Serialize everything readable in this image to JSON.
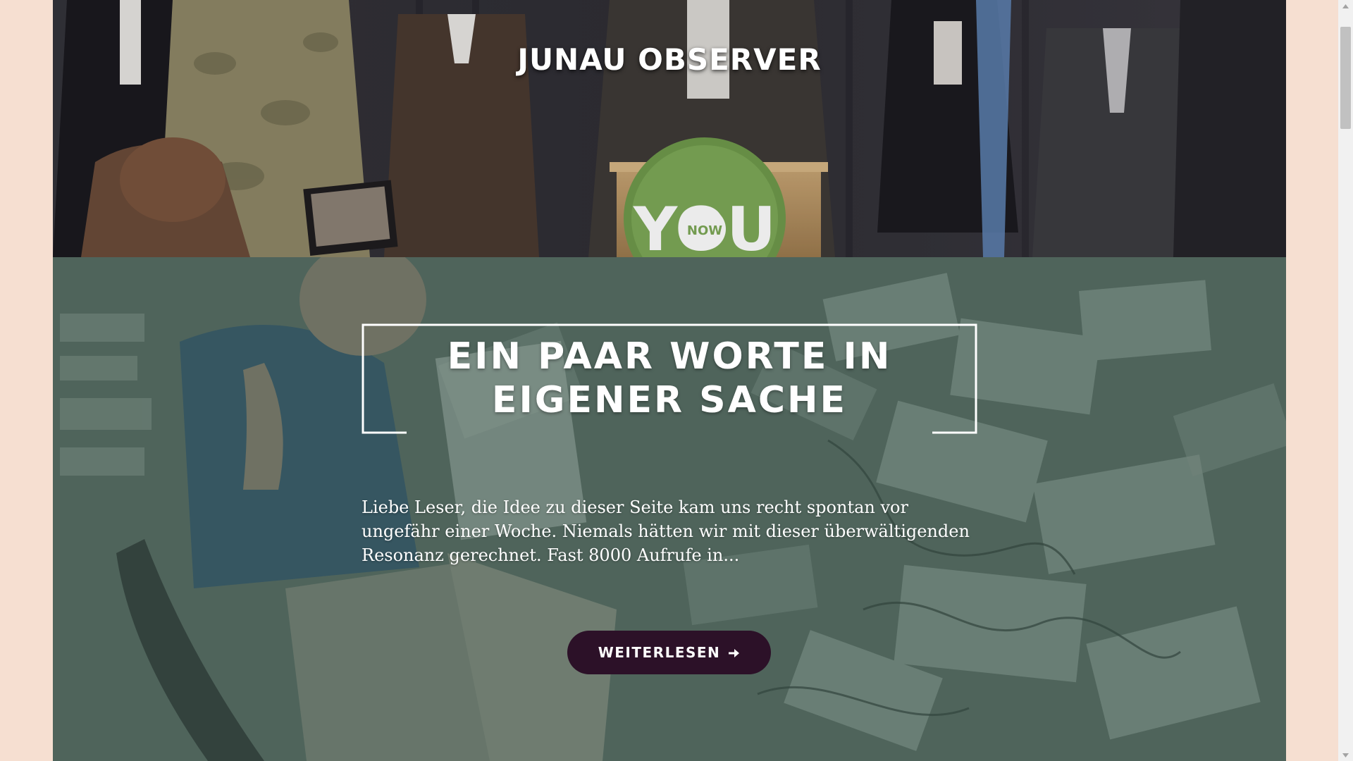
{
  "header": {
    "site_title": "JUNAU OBSERVER",
    "podium_logo_text": "YOU",
    "podium_logo_subtext": "NOW"
  },
  "post": {
    "title": "EIN PAAR WORTE IN EIGENER SACHE",
    "excerpt": "Liebe Leser, die Idee zu dieser Seite kam uns recht spontan vor ungefähr einer Woche. Niemals hätten wir mit dieser überwältigenden Resonanz gerechnet. Fast 8000 Aufrufe in...",
    "read_more_label": "WEITERLESEN",
    "read_more_icon": "arrow-right-icon"
  },
  "colors": {
    "page_background": "#f6dfd1",
    "button_background": "#2c1128",
    "post_overlay": "#55695f",
    "text": "#ffffff"
  }
}
